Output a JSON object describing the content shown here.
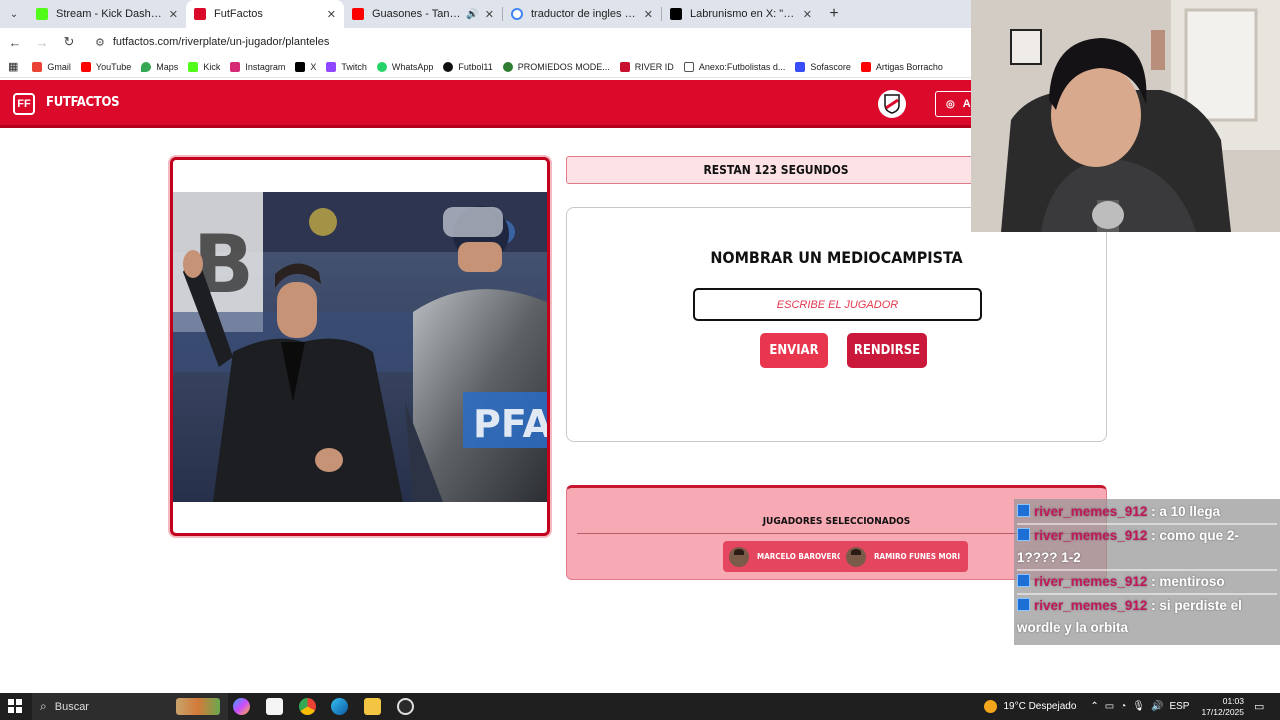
{
  "browser": {
    "tabs": [
      {
        "title": "Stream - Kick Dashboard",
        "color": "#53fc18"
      },
      {
        "title": "FutFactos",
        "color": "#dc0a2a",
        "active": true
      },
      {
        "title": "Guasones - Tan distintos Ft",
        "color": "#ff0000",
        "audio": true
      },
      {
        "title": "traductor de ingles - Buscar con",
        "color": "#4285f4"
      },
      {
        "title": "Labrunismo en X: \"Toda la vida",
        "color": "#000000"
      }
    ],
    "url": "futfactos.com/riverplate/un-jugador/planteles",
    "bookmarks": [
      {
        "label": "Gmail",
        "color": "#ea4335"
      },
      {
        "label": "YouTube",
        "color": "#ff0000"
      },
      {
        "label": "Maps",
        "color": "#34a853"
      },
      {
        "label": "Kick",
        "color": "#53fc18"
      },
      {
        "label": "Instagram",
        "color": "#d62976"
      },
      {
        "label": "X",
        "color": "#000000"
      },
      {
        "label": "Twitch",
        "color": "#9146ff"
      },
      {
        "label": "WhatsApp",
        "color": "#25d366"
      },
      {
        "label": "Futbol11",
        "color": "#111111"
      },
      {
        "label": "PROMIEDOS MODE...",
        "color": "#2e7d32"
      },
      {
        "label": "RIVER ID",
        "color": "#c8102e"
      },
      {
        "label": "Anexo:Futbolistas d...",
        "color": "#555555"
      },
      {
        "label": "Sofascore",
        "color": "#374df5"
      },
      {
        "label": "Artigas Borracho",
        "color": "#ff0000"
      }
    ]
  },
  "site": {
    "brand": "FUTFACTOS",
    "logo_letters": "FF",
    "account_label": "A",
    "accent": "#dc0a2a"
  },
  "game": {
    "timer_text": "RESTAN 123 SEGUNDOS",
    "prompt": "NOMBRAR UN MEDIOCAMPISTA",
    "input_placeholder": "ESCRIBE EL JUGADOR",
    "input_value": "",
    "send_label": "ENVIAR",
    "giveup_label": "RENDIRSE",
    "selected_title": "JUGADORES SELECCIONADOS",
    "selected_players": [
      "MARCELO BAROVERO",
      "RAMIRO FUNES MORI"
    ]
  },
  "chat": [
    {
      "user": "river_memes_912",
      "text": ": a 10 llega"
    },
    {
      "user": "river_memes_912",
      "text": ": como que 2-1???? 1-2"
    },
    {
      "user": "river_memes_912",
      "text": ": mentiroso"
    },
    {
      "user": "river_memes_912",
      "text": ": si perdiste el wordle y la orbita"
    }
  ],
  "taskbar": {
    "search_placeholder": "Buscar",
    "weather": "19°C  Despejado",
    "lang": "ESP",
    "time": "01:03",
    "date": "17/12/2025"
  }
}
